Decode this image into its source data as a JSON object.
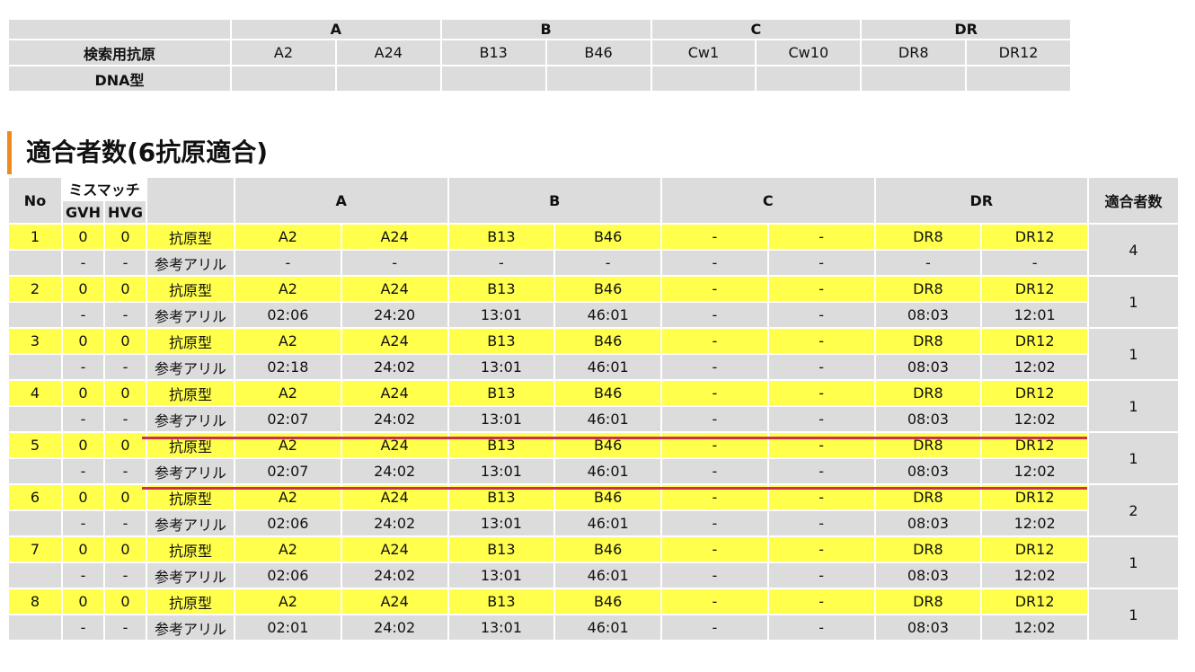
{
  "search_table": {
    "groups": [
      "A",
      "B",
      "C",
      "DR"
    ],
    "antigen_label": "検索用抗原",
    "antigens": [
      "A2",
      "A24",
      "B13",
      "B46",
      "Cw1",
      "Cw10",
      "DR8",
      "DR12"
    ],
    "dna_label": "DNA型",
    "dna_values": [
      "",
      "",
      "",
      "",
      "",
      "",
      "",
      ""
    ]
  },
  "section_title": "適合者数(6抗原適合)",
  "results_header": {
    "no": "No",
    "mismatch": "ミスマッチ",
    "gvh": "GVH",
    "hvg": "HVG",
    "groups": [
      "A",
      "B",
      "C",
      "DR"
    ],
    "count": "適合者数"
  },
  "rows": [
    {
      "no": "1",
      "gvh": "0",
      "hvg": "0",
      "type_label": "抗原型",
      "antigens": [
        "A2",
        "A24",
        "B13",
        "B46",
        "-",
        "-",
        "DR8",
        "DR12"
      ],
      "gvh_ref": "-",
      "hvg_ref": "-",
      "ref_label": "参考アリル",
      "alleles": [
        "-",
        "-",
        "-",
        "-",
        "-",
        "-",
        "-",
        "-"
      ],
      "count": "4"
    },
    {
      "no": "2",
      "gvh": "0",
      "hvg": "0",
      "type_label": "抗原型",
      "antigens": [
        "A2",
        "A24",
        "B13",
        "B46",
        "-",
        "-",
        "DR8",
        "DR12"
      ],
      "gvh_ref": "-",
      "hvg_ref": "-",
      "ref_label": "参考アリル",
      "alleles": [
        "02:06",
        "24:20",
        "13:01",
        "46:01",
        "-",
        "-",
        "08:03",
        "12:01"
      ],
      "count": "1"
    },
    {
      "no": "3",
      "gvh": "0",
      "hvg": "0",
      "type_label": "抗原型",
      "antigens": [
        "A2",
        "A24",
        "B13",
        "B46",
        "-",
        "-",
        "DR8",
        "DR12"
      ],
      "gvh_ref": "-",
      "hvg_ref": "-",
      "ref_label": "参考アリル",
      "alleles": [
        "02:18",
        "24:02",
        "13:01",
        "46:01",
        "-",
        "-",
        "08:03",
        "12:02"
      ],
      "count": "1"
    },
    {
      "no": "4",
      "gvh": "0",
      "hvg": "0",
      "type_label": "抗原型",
      "antigens": [
        "A2",
        "A24",
        "B13",
        "B46",
        "-",
        "-",
        "DR8",
        "DR12"
      ],
      "gvh_ref": "-",
      "hvg_ref": "-",
      "ref_label": "参考アリル",
      "alleles": [
        "02:07",
        "24:02",
        "13:01",
        "46:01",
        "-",
        "-",
        "08:03",
        "12:02"
      ],
      "count": "1"
    },
    {
      "no": "5",
      "gvh": "0",
      "hvg": "0",
      "type_label": "抗原型",
      "antigens": [
        "A2",
        "A24",
        "B13",
        "B46",
        "-",
        "-",
        "DR8",
        "DR12"
      ],
      "gvh_ref": "-",
      "hvg_ref": "-",
      "ref_label": "参考アリル",
      "alleles": [
        "02:07",
        "24:02",
        "13:01",
        "46:01",
        "-",
        "-",
        "08:03",
        "12:02"
      ],
      "count": "1"
    },
    {
      "no": "6",
      "gvh": "0",
      "hvg": "0",
      "type_label": "抗原型",
      "antigens": [
        "A2",
        "A24",
        "B13",
        "B46",
        "-",
        "-",
        "DR8",
        "DR12"
      ],
      "gvh_ref": "-",
      "hvg_ref": "-",
      "ref_label": "参考アリル",
      "alleles": [
        "02:06",
        "24:02",
        "13:01",
        "46:01",
        "-",
        "-",
        "08:03",
        "12:02"
      ],
      "count": "2"
    },
    {
      "no": "7",
      "gvh": "0",
      "hvg": "0",
      "type_label": "抗原型",
      "antigens": [
        "A2",
        "A24",
        "B13",
        "B46",
        "-",
        "-",
        "DR8",
        "DR12"
      ],
      "gvh_ref": "-",
      "hvg_ref": "-",
      "ref_label": "参考アリル",
      "alleles": [
        "02:06",
        "24:02",
        "13:01",
        "46:01",
        "-",
        "-",
        "08:03",
        "12:02"
      ],
      "count": "1"
    },
    {
      "no": "8",
      "gvh": "0",
      "hvg": "0",
      "type_label": "抗原型",
      "antigens": [
        "A2",
        "A24",
        "B13",
        "B46",
        "-",
        "-",
        "DR8",
        "DR12"
      ],
      "gvh_ref": "-",
      "hvg_ref": "-",
      "ref_label": "参考アリル",
      "alleles": [
        "02:01",
        "24:02",
        "13:01",
        "46:01",
        "-",
        "-",
        "08:03",
        "12:02"
      ],
      "count": "1"
    }
  ],
  "colors": {
    "antigen_row": "#ffff4c",
    "reference_row": "#dcdcdc",
    "accent_bar": "#f08a1e",
    "highlight_line": "#d0304c"
  },
  "highlighted_row_no": "5"
}
